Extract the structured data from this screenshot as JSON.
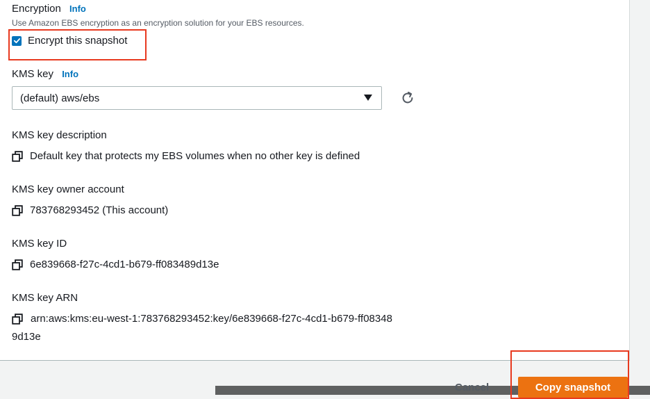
{
  "encryption": {
    "title": "Encryption",
    "info": "Info",
    "description": "Use Amazon EBS encryption as an encryption solution for your EBS resources.",
    "checkbox_label": "Encrypt this snapshot",
    "checkbox_checked": true
  },
  "kms_key": {
    "label": "KMS key",
    "info": "Info",
    "selected_value": "(default) aws/ebs"
  },
  "details": {
    "description_label": "KMS key description",
    "description_value": "Default key that protects my EBS volumes when no other key is defined",
    "owner_label": "KMS key owner account",
    "owner_value": "783768293452 (This account)",
    "id_label": "KMS key ID",
    "id_value": "6e839668-f27c-4cd1-b679-ff083489d13e",
    "arn_label": "KMS key ARN",
    "arn_value": "arn:aws:kms:eu-west-1:783768293452:key/6e839668-f27c-4cd1-b679-ff083489d13e"
  },
  "footer": {
    "cancel_label": "Cancel",
    "submit_label": "Copy snapshot"
  },
  "colors": {
    "accent": "#0073bb",
    "primary_button": "#ec7211",
    "highlight": "#e8391f"
  },
  "icons": {
    "checkbox": "check-icon",
    "select": "caret-down-icon",
    "refresh": "refresh-icon",
    "copy": "copy-icon"
  }
}
